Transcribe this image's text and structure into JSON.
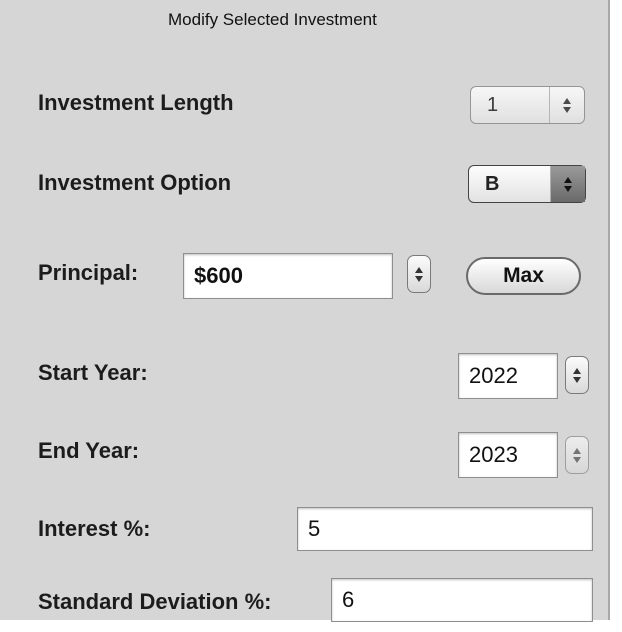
{
  "title": "Modify Selected Investment",
  "investment_length": {
    "label": "Investment Length",
    "value": "1"
  },
  "investment_option": {
    "label": "Investment Option",
    "value": "B"
  },
  "principal": {
    "label": "Principal:",
    "value": "$600",
    "max_label": "Max"
  },
  "start_year": {
    "label": "Start Year:",
    "value": "2022"
  },
  "end_year": {
    "label": "End Year:",
    "value": "2023"
  },
  "interest": {
    "label": "Interest %:",
    "value": "5"
  },
  "std_dev": {
    "label": "Standard Deviation %:",
    "value": "6"
  },
  "icons": [
    "up-down-arrows-icon",
    "stepper-arrows-icon"
  ]
}
